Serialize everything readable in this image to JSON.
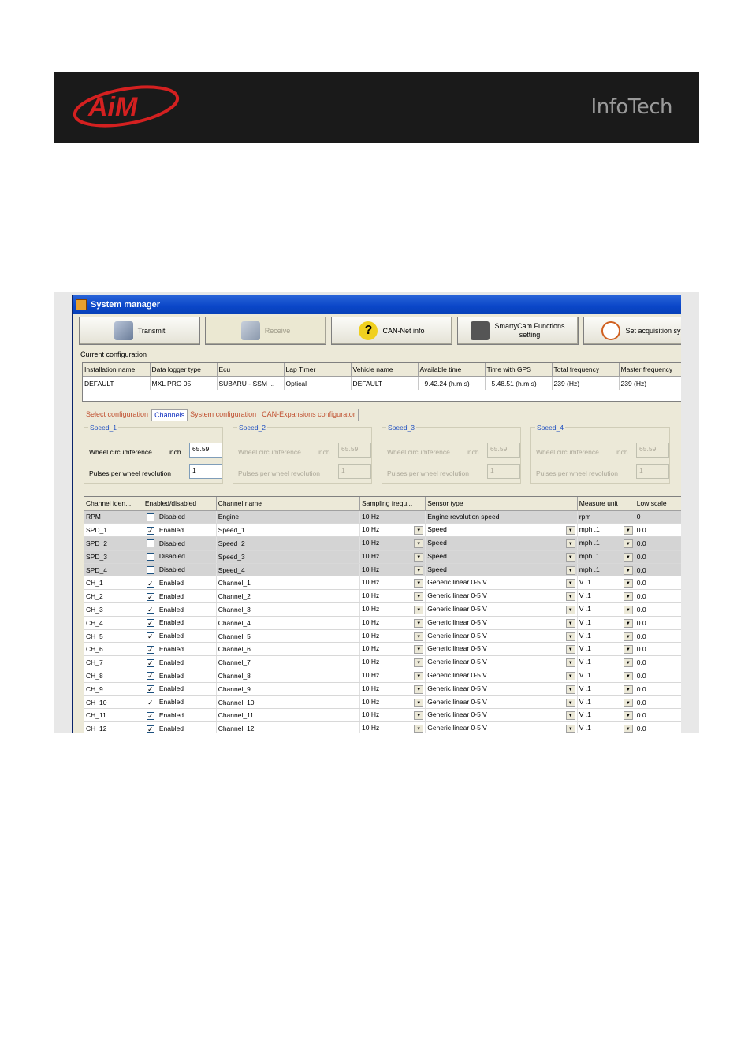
{
  "banner": {
    "brand_text": "InfoTech",
    "logo_name": "aim-logo"
  },
  "window": {
    "title": "System manager"
  },
  "toolbar": {
    "buttons": [
      {
        "label": "Transmit",
        "icon": "transmit-icon"
      },
      {
        "label": "Receive",
        "icon": "receive-icon"
      },
      {
        "label": "CAN-Net info",
        "icon": "question-icon"
      },
      {
        "label": "SmartyCam Functions setting",
        "icon": "camera-icon"
      },
      {
        "label": "Set acquisition syst",
        "icon": "clock-icon"
      }
    ]
  },
  "current_config": {
    "label": "Current configuration",
    "headers": [
      "Installation name",
      "Data logger type",
      "Ecu",
      "Lap Timer",
      "Vehicle name",
      "Available time",
      "Time with GPS",
      "Total frequency",
      "Master frequency"
    ],
    "row": [
      "DEFAULT",
      "MXL PRO 05",
      "SUBARU - SSM ...",
      "Optical",
      "DEFAULT",
      "9.42.24 (h.m.s)",
      "5.48.51 (h.m.s)",
      "239 (Hz)",
      "239 (Hz)"
    ]
  },
  "tabs": [
    "Select configuration",
    "Channels",
    "System configuration",
    "CAN-Expansions configurator"
  ],
  "speed_groups": [
    {
      "title": "Speed_1",
      "wheel_label": "Wheel circumference",
      "unit": "inch",
      "wheel_value": "65.59",
      "pulses_label": "Pulses per wheel revolution",
      "pulses_value": "1"
    },
    {
      "title": "Speed_2",
      "wheel_label": "Wheel circumference",
      "unit": "inch",
      "wheel_value": "65.59",
      "pulses_label": "Pulses per wheel revolution",
      "pulses_value": "1"
    },
    {
      "title": "Speed_3",
      "wheel_label": "Wheel circumference",
      "unit": "inch",
      "wheel_value": "65.59",
      "pulses_label": "Pulses per wheel revolution",
      "pulses_value": "1"
    },
    {
      "title": "Speed_4",
      "wheel_label": "Wheel circumference",
      "unit": "inch",
      "wheel_value": "65.59",
      "pulses_label": "Pulses per wheel revolution",
      "pulses_value": "1"
    }
  ],
  "channels": {
    "headers": [
      "Channel iden...",
      "Enabled/disabled",
      "Channel name",
      "Sampling frequ...",
      "Sensor type",
      "Measure unit",
      "Low scale"
    ],
    "rows": [
      {
        "id": "RPM",
        "checked": false,
        "state": "Disabled",
        "name": "Engine",
        "freq": "10 Hz",
        "sensor": "Engine revolution speed",
        "unit": "rpm",
        "low": "0",
        "grey": true,
        "dropdowns": false
      },
      {
        "id": "SPD_1",
        "checked": true,
        "state": "Enabled",
        "name": "Speed_1",
        "freq": "10 Hz",
        "sensor": "Speed",
        "unit": "mph .1",
        "low": "0.0",
        "grey": false,
        "dropdowns": true
      },
      {
        "id": "SPD_2",
        "checked": false,
        "state": "Disabled",
        "name": "Speed_2",
        "freq": "10 Hz",
        "sensor": "Speed",
        "unit": "mph .1",
        "low": "0.0",
        "grey": true,
        "dropdowns": true
      },
      {
        "id": "SPD_3",
        "checked": false,
        "state": "Disabled",
        "name": "Speed_3",
        "freq": "10 Hz",
        "sensor": "Speed",
        "unit": "mph .1",
        "low": "0.0",
        "grey": true,
        "dropdowns": true
      },
      {
        "id": "SPD_4",
        "checked": false,
        "state": "Disabled",
        "name": "Speed_4",
        "freq": "10 Hz",
        "sensor": "Speed",
        "unit": "mph .1",
        "low": "0.0",
        "grey": true,
        "dropdowns": true
      },
      {
        "id": "CH_1",
        "checked": true,
        "state": "Enabled",
        "name": "Channel_1",
        "freq": "10 Hz",
        "sensor": "Generic linear 0-5 V",
        "unit": "V .1",
        "low": "0.0",
        "grey": false,
        "dropdowns": true
      },
      {
        "id": "CH_2",
        "checked": true,
        "state": "Enabled",
        "name": "Channel_2",
        "freq": "10 Hz",
        "sensor": "Generic linear 0-5 V",
        "unit": "V .1",
        "low": "0.0",
        "grey": false,
        "dropdowns": true
      },
      {
        "id": "CH_3",
        "checked": true,
        "state": "Enabled",
        "name": "Channel_3",
        "freq": "10 Hz",
        "sensor": "Generic linear 0-5 V",
        "unit": "V .1",
        "low": "0.0",
        "grey": false,
        "dropdowns": true
      },
      {
        "id": "CH_4",
        "checked": true,
        "state": "Enabled",
        "name": "Channel_4",
        "freq": "10 Hz",
        "sensor": "Generic linear 0-5 V",
        "unit": "V .1",
        "low": "0.0",
        "grey": false,
        "dropdowns": true
      },
      {
        "id": "CH_5",
        "checked": true,
        "state": "Enabled",
        "name": "Channel_5",
        "freq": "10 Hz",
        "sensor": "Generic linear 0-5 V",
        "unit": "V .1",
        "low": "0.0",
        "grey": false,
        "dropdowns": true
      },
      {
        "id": "CH_6",
        "checked": true,
        "state": "Enabled",
        "name": "Channel_6",
        "freq": "10 Hz",
        "sensor": "Generic linear 0-5 V",
        "unit": "V .1",
        "low": "0.0",
        "grey": false,
        "dropdowns": true
      },
      {
        "id": "CH_7",
        "checked": true,
        "state": "Enabled",
        "name": "Channel_7",
        "freq": "10 Hz",
        "sensor": "Generic linear 0-5 V",
        "unit": "V .1",
        "low": "0.0",
        "grey": false,
        "dropdowns": true
      },
      {
        "id": "CH_8",
        "checked": true,
        "state": "Enabled",
        "name": "Channel_8",
        "freq": "10 Hz",
        "sensor": "Generic linear 0-5 V",
        "unit": "V .1",
        "low": "0.0",
        "grey": false,
        "dropdowns": true
      },
      {
        "id": "CH_9",
        "checked": true,
        "state": "Enabled",
        "name": "Channel_9",
        "freq": "10 Hz",
        "sensor": "Generic linear 0-5 V",
        "unit": "V .1",
        "low": "0.0",
        "grey": false,
        "dropdowns": true
      },
      {
        "id": "CH_10",
        "checked": true,
        "state": "Enabled",
        "name": "Channel_10",
        "freq": "10 Hz",
        "sensor": "Generic linear 0-5 V",
        "unit": "V .1",
        "low": "0.0",
        "grey": false,
        "dropdowns": true
      },
      {
        "id": "CH_11",
        "checked": true,
        "state": "Enabled",
        "name": "Channel_11",
        "freq": "10 Hz",
        "sensor": "Generic linear 0-5 V",
        "unit": "V .1",
        "low": "0.0",
        "grey": false,
        "dropdowns": true
      },
      {
        "id": "CH_12",
        "checked": true,
        "state": "Enabled",
        "name": "Channel_12",
        "freq": "10 Hz",
        "sensor": "Generic linear 0-5 V",
        "unit": "V .1",
        "low": "0.0",
        "grey": false,
        "dropdowns": true
      }
    ]
  },
  "colors": {
    "banner_bg": "#1a1a1a",
    "logo_red": "#d42020",
    "titlebar": "#0a46c8",
    "disabled_row": "#d4d4d4"
  }
}
